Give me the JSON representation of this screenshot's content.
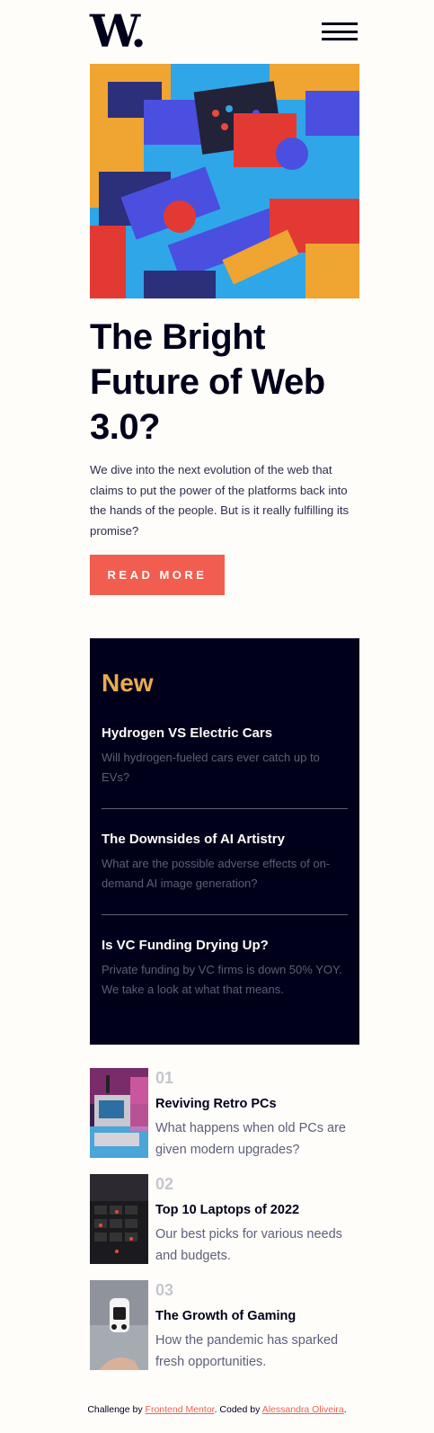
{
  "header": {
    "logo": "W.",
    "menu_icon": "hamburger-icon"
  },
  "hero": {
    "title": "The Bright Future of Web 3.0?",
    "lead": "We dive into the next evolution of the web that claims to put the power of the platforms back into the hands of the people. But is it really fulfilling its promise?",
    "button_label": "Read more"
  },
  "new_panel": {
    "heading": "New",
    "items": [
      {
        "title": "Hydrogen VS Electric Cars",
        "text": "Will hydrogen-fueled cars ever catch up to EVs?"
      },
      {
        "title": "The Downsides of AI Artistry",
        "text": "What are the possible adverse effects of on-demand AI image generation?"
      },
      {
        "title": "Is VC Funding Drying Up?",
        "text": "Private funding by VC firms is down 50% YOY. We take a look at what that means."
      }
    ]
  },
  "list": [
    {
      "number": "01",
      "title": "Reviving Retro PCs",
      "text": "What happens when old PCs are given modern upgrades?"
    },
    {
      "number": "02",
      "title": "Top 10 Laptops of 2022",
      "text": "Our best picks for various needs and budgets."
    },
    {
      "number": "03",
      "title": "The Growth of Gaming",
      "text": "How the pandemic has sparked fresh opportunities."
    }
  ],
  "footer": {
    "prefix": "Challenge by",
    "link1": "Frontend Mentor",
    "middle": ". Coded by",
    "link2": "Alessandra Oliveira",
    "suffix": "."
  },
  "colors": {
    "accent": "#f15e50",
    "orange": "#e9ab53",
    "dark_navy": "#00001a",
    "grayish_blue": "#5d5f79",
    "off_white": "#fffdfa"
  }
}
